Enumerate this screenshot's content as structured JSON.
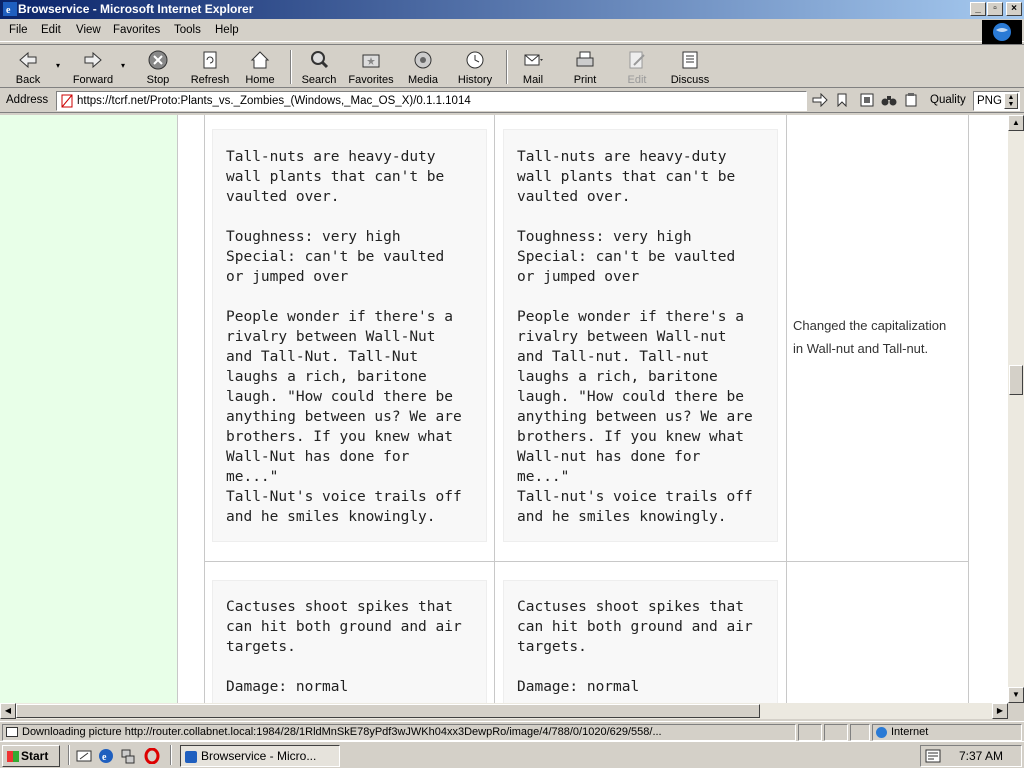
{
  "window": {
    "title": "Browservice - Microsoft Internet Explorer"
  },
  "menu": [
    "File",
    "Edit",
    "View",
    "Favorites",
    "Tools",
    "Help"
  ],
  "toolbar": {
    "back": "Back",
    "forward": "Forward",
    "stop": "Stop",
    "refresh": "Refresh",
    "home": "Home",
    "search": "Search",
    "favorites": "Favorites",
    "media": "Media",
    "history": "History",
    "mail": "Mail",
    "print": "Print",
    "edit": "Edit",
    "discuss": "Discuss"
  },
  "address": {
    "label": "Address",
    "url": "https://tcrf.net/Proto:Plants_vs._Zombies_(Windows,_Mac_OS_X)/0.1.1.1014",
    "quality_label": "Quality",
    "quality_value": "PNG"
  },
  "page": {
    "rows": [
      {
        "old_text": "Tall-nuts are heavy-duty\nwall plants that can't be\nvaulted over.\n\nToughness: very high\nSpecial: can't be vaulted\nor jumped over\n\nPeople wonder if there's a\nrivalry between Wall-Nut\nand Tall-Nut. Tall-Nut\nlaughs a rich, baritone\nlaugh. \"How could there be\nanything between us? We are\nbrothers. If you knew what\nWall-Nut has done for\nme...\"\nTall-Nut's voice trails off\nand he smiles knowingly.",
        "new_text": "Tall-nuts are heavy-duty\nwall plants that can't be\nvaulted over.\n\nToughness: very high\nSpecial: can't be vaulted\nor jumped over\n\nPeople wonder if there's a\nrivalry between Wall-nut\nand Tall-nut. Tall-nut\nlaughs a rich, baritone\nlaugh. \"How could there be\nanything between us? We are\nbrothers. If you knew what\nWall-nut has done for\nme...\"\nTall-nut's voice trails off\nand he smiles knowingly.",
        "note": "Changed the capitalization\nin Wall-nut and Tall-nut."
      },
      {
        "old_text": "Cactuses shoot spikes that\ncan hit both ground and air\ntargets.\n\nDamage: normal",
        "new_text": "Cactuses shoot spikes that\ncan hit both ground and air\ntargets.\n\nDamage: normal",
        "note": ""
      }
    ]
  },
  "status": {
    "text": "Downloading picture http://router.collabnet.local:1984/28/1RldMnSkE78yPdf3wJWKh04xx3DewpRo/image/4/788/0/1020/629/558/...",
    "zone": "Internet"
  },
  "taskbar": {
    "start": "Start",
    "task": "Browservice - Micro...",
    "clock": "7:37 AM"
  }
}
